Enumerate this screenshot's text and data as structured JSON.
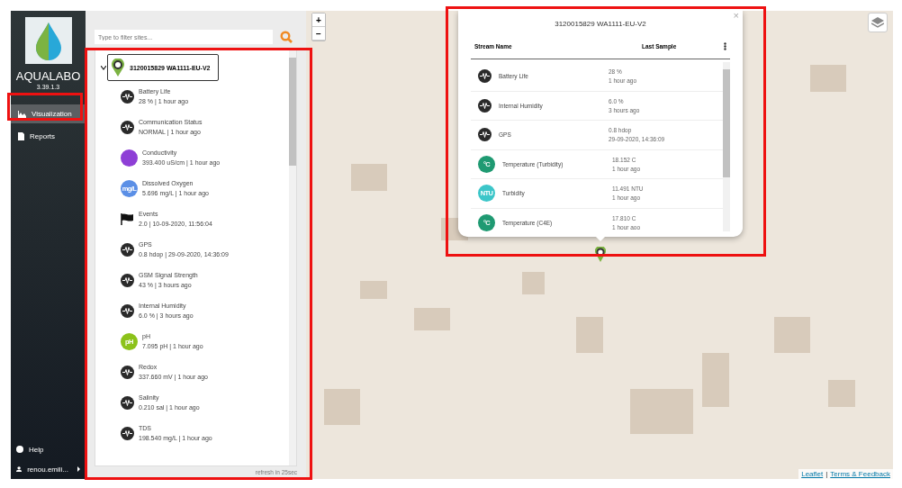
{
  "sidebar": {
    "brand": "AQUALABO",
    "version": "3.39.1.3",
    "items": [
      {
        "label": "Visualization",
        "selected": true
      },
      {
        "label": "Reports",
        "selected": false
      }
    ],
    "footer": [
      {
        "label": "Help"
      },
      {
        "label": "renou.emili..."
      }
    ]
  },
  "panel": {
    "search": {
      "placeholder": "Type to filter sites..."
    },
    "site": {
      "name": "3120015829 WA1111-EU-V2",
      "expanded": true
    },
    "streams": [
      {
        "name": "Battery Life",
        "reading": "28 % | 1 hour ago",
        "kind": "wave"
      },
      {
        "name": "Communication Status",
        "reading": "NORMAL | 1 hour ago",
        "kind": "wave"
      },
      {
        "name": "Conductivity",
        "reading": "393.400 uS/cm | 1 hour ago",
        "kind": "badge",
        "color": "#8e3fd6"
      },
      {
        "name": "Dissolved Oxygen",
        "reading": "5.696 mg/L | 1 hour ago",
        "kind": "badge",
        "color": "#5b8fe6",
        "badge": "mg/L"
      },
      {
        "name": "Events",
        "reading": "2.0 | 10-09-2020, 11:56:04",
        "kind": "flag"
      },
      {
        "name": "GPS",
        "reading": "0.8 hdop | 29-09-2020, 14:36:09",
        "kind": "wave"
      },
      {
        "name": "GSM Signal Strength",
        "reading": "43 % | 3 hours ago",
        "kind": "wave"
      },
      {
        "name": "Internal Humidity",
        "reading": "6.0 % | 3 hours ago",
        "kind": "wave"
      },
      {
        "name": "pH",
        "reading": "7.095 pH | 1 hour ago",
        "kind": "badge",
        "color": "#8cc21a",
        "badge": "pH"
      },
      {
        "name": "Redox",
        "reading": "337.660 mV | 1 hour ago",
        "kind": "wave"
      },
      {
        "name": "Salinity",
        "reading": "0.210 sal | 1 hour ago",
        "kind": "wave"
      },
      {
        "name": "TDS",
        "reading": "198.540 mg/L | 1 hour ago",
        "kind": "wave"
      }
    ],
    "refresh": "refresh in 25sec"
  },
  "map": {
    "zoom_in": "+",
    "zoom_out": "−",
    "attribution": [
      {
        "label": "Leaflet"
      },
      {
        "label": "Terms & Feedback"
      }
    ],
    "attribution_separator": "|",
    "popup": {
      "close": "×",
      "title": "3120015829 WA1111-EU-V2",
      "columns": [
        "Stream Name",
        "Last Sample"
      ],
      "rows": [
        {
          "name": "Battery Life",
          "value": "28 %",
          "time": "1 hour ago",
          "kind": "wave"
        },
        {
          "name": "Internal Humidity",
          "value": "6.0 %",
          "time": "3 hours ago",
          "kind": "wave"
        },
        {
          "name": "GPS",
          "value": "0.8 hdop",
          "time": "29-09-2020, 14:36:09",
          "kind": "wave"
        },
        {
          "name": "Temperature (Turbidity)",
          "value": "18.152 C",
          "time": "1 hour ago",
          "kind": "badge",
          "color": "#1f9a72",
          "badge": "°C"
        },
        {
          "name": "Turbidity",
          "value": "11.491 NTU",
          "time": "1 hour ago",
          "kind": "badge",
          "color": "#3cc6c9",
          "badge": "NTU"
        },
        {
          "name": "Temperature (C4E)",
          "value": "17.810 C",
          "time": "1 hour aoo",
          "kind": "badge",
          "color": "#1f9a72",
          "badge": "°C"
        }
      ]
    }
  }
}
